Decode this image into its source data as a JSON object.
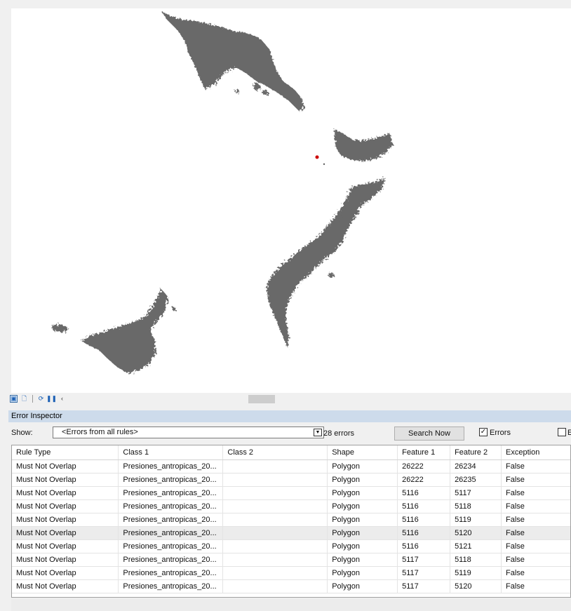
{
  "map": {
    "feature_color": "#626262",
    "highlight_color": "#cc0000"
  },
  "toolbar": {
    "icons": [
      "layer-view-icon",
      "layout-view-icon",
      "refresh-icon",
      "pause-icon",
      "back-arrow-icon"
    ]
  },
  "panel": {
    "title": "Error Inspector",
    "show_label": "Show:",
    "show_value": "<Errors from all rules>",
    "error_count": "28 errors",
    "search_button": "Search Now",
    "errors_checkbox_label": "Errors",
    "errors_checked": true,
    "exceptions_checkbox_label": "E"
  },
  "table": {
    "columns": [
      "Rule Type",
      "Class 1",
      "Class 2",
      "Shape",
      "Feature 1",
      "Feature 2",
      "Exception"
    ],
    "rows": [
      [
        "Must Not Overlap",
        "Presiones_antropicas_20...",
        "",
        "Polygon",
        "26222",
        "26234",
        "False"
      ],
      [
        "Must Not Overlap",
        "Presiones_antropicas_20...",
        "",
        "Polygon",
        "26222",
        "26235",
        "False"
      ],
      [
        "Must Not Overlap",
        "Presiones_antropicas_20...",
        "",
        "Polygon",
        "5116",
        "5117",
        "False"
      ],
      [
        "Must Not Overlap",
        "Presiones_antropicas_20...",
        "",
        "Polygon",
        "5116",
        "5118",
        "False"
      ],
      [
        "Must Not Overlap",
        "Presiones_antropicas_20...",
        "",
        "Polygon",
        "5116",
        "5119",
        "False"
      ],
      [
        "Must Not Overlap",
        "Presiones_antropicas_20...",
        "",
        "Polygon",
        "5116",
        "5120",
        "False"
      ],
      [
        "Must Not Overlap",
        "Presiones_antropicas_20...",
        "",
        "Polygon",
        "5116",
        "5121",
        "False"
      ],
      [
        "Must Not Overlap",
        "Presiones_antropicas_20...",
        "",
        "Polygon",
        "5117",
        "5118",
        "False"
      ],
      [
        "Must Not Overlap",
        "Presiones_antropicas_20...",
        "",
        "Polygon",
        "5117",
        "5119",
        "False"
      ],
      [
        "Must Not Overlap",
        "Presiones_antropicas_20...",
        "",
        "Polygon",
        "5117",
        "5120",
        "False"
      ]
    ],
    "selected_row": 5
  }
}
